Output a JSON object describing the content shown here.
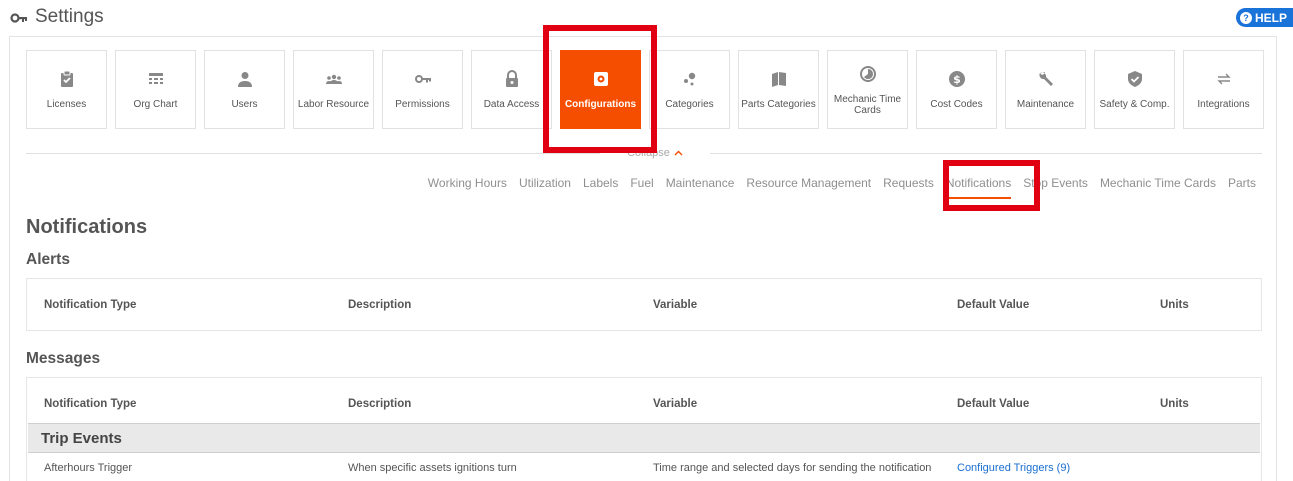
{
  "header": {
    "title": "Settings",
    "help_label": "HELP"
  },
  "tiles": [
    {
      "label": "Licenses",
      "icon": "clipboard-check-icon"
    },
    {
      "label": "Org Chart",
      "icon": "org-chart-icon"
    },
    {
      "label": "Users",
      "icon": "user-icon"
    },
    {
      "label": "Labor Resource",
      "icon": "people-icon"
    },
    {
      "label": "Permissions",
      "icon": "key-icon"
    },
    {
      "label": "Data Access",
      "icon": "lock-icon"
    },
    {
      "label": "Configurations",
      "icon": "gear-icon",
      "active": true
    },
    {
      "label": "Categories",
      "icon": "dots-icon"
    },
    {
      "label": "Parts Categories",
      "icon": "book-icon"
    },
    {
      "label": "Mechanic Time Cards",
      "icon": "clock-icon"
    },
    {
      "label": "Cost Codes",
      "icon": "dollar-icon"
    },
    {
      "label": "Maintenance",
      "icon": "wrench-icon"
    },
    {
      "label": "Safety & Comp.",
      "icon": "shield-check-icon"
    },
    {
      "label": "Integrations",
      "icon": "arrows-icon"
    }
  ],
  "collapse_label": "Collapse",
  "subnav": [
    "Working Hours",
    "Utilization",
    "Labels",
    "Fuel",
    "Maintenance",
    "Resource Management",
    "Requests",
    "Notifications",
    "Stop Events",
    "Mechanic Time Cards",
    "Parts"
  ],
  "subnav_active": "Notifications",
  "page_title": "Notifications",
  "alerts": {
    "title": "Alerts",
    "columns": [
      "Notification Type",
      "Description",
      "Variable",
      "Default Value",
      "Units"
    ]
  },
  "messages": {
    "title": "Messages",
    "columns": [
      "Notification Type",
      "Description",
      "Variable",
      "Default Value",
      "Units"
    ],
    "group": "Trip Events",
    "rows": [
      {
        "type": "Afterhours Trigger",
        "description": "When specific assets ignitions turn",
        "variable": "Time range and selected days for sending the notification",
        "default": "Configured Triggers (9)"
      }
    ]
  },
  "colors": {
    "accent": "#f54e00",
    "highlight": "#e00012",
    "link": "#1a6fd0",
    "help": "#1a73d9"
  }
}
